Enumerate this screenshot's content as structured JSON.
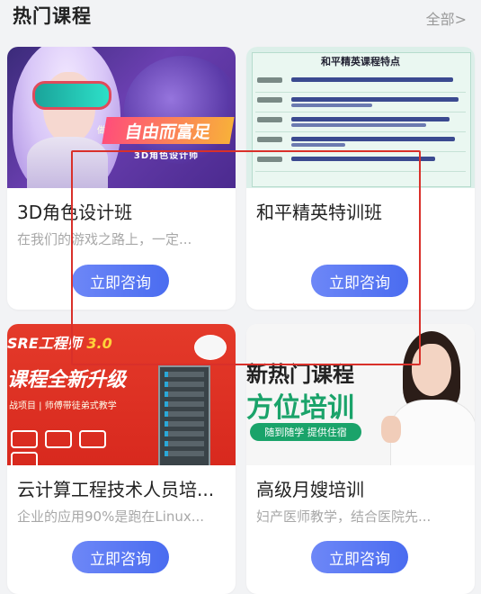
{
  "header": {
    "title": "热门课程",
    "see_all": "全部>"
  },
  "courses": [
    {
      "title": "3D角色设计班",
      "desc": "在我们的游戏之路上，一定...",
      "button": "立即咨询",
      "thumb": {
        "banner": "自由而富足",
        "subtitle": "3D角色设计师",
        "small": "做个"
      }
    },
    {
      "title": "和平精英特训班",
      "desc": "",
      "button": "立即咨询",
      "thumb": {
        "heading": "和平精英课程特点"
      }
    },
    {
      "title": "云计算工程技术人员培...",
      "desc": "企业的应用90%是跑在Linux...",
      "button": "立即咨询",
      "thumb": {
        "tag": "SRE工程师",
        "version": "3.0",
        "headline": "课程全新升级",
        "line": "战项目 | 师傅带徒弟式教学"
      }
    },
    {
      "title": "高级月嫂培训",
      "desc": "妇产医师教学，结合医院先...",
      "button": "立即咨询",
      "thumb": {
        "line1": "新热门课程",
        "line2": "方位培训",
        "pill": "随到随学 提供住宿"
      }
    }
  ],
  "colors": {
    "accent": "#4a6cf0",
    "highlight": "#d9302a"
  }
}
